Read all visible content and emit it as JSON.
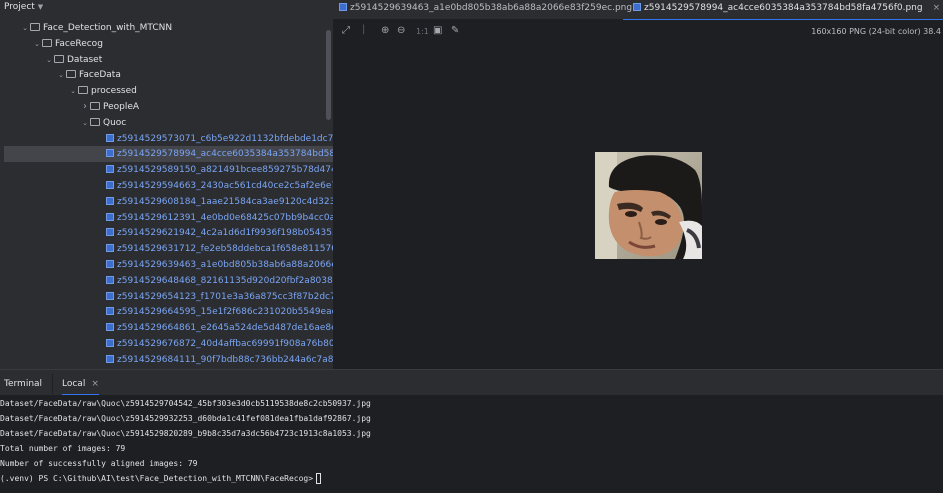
{
  "project": {
    "title": "Project",
    "tree": [
      {
        "label": "Face_Detection_with_MTCNN",
        "kind": "dir",
        "depth": 1,
        "expanded": true
      },
      {
        "label": "FaceRecog",
        "kind": "dir",
        "depth": 2,
        "expanded": true
      },
      {
        "label": "Dataset",
        "kind": "dir",
        "depth": 3,
        "expanded": true
      },
      {
        "label": "FaceData",
        "kind": "dir",
        "depth": 4,
        "expanded": true
      },
      {
        "label": "processed",
        "kind": "dir",
        "depth": 5,
        "expanded": true
      },
      {
        "label": "PeopleA",
        "kind": "dir",
        "depth": 6,
        "expanded": false
      },
      {
        "label": "Quoc",
        "kind": "dir",
        "depth": 6,
        "expanded": true
      },
      {
        "label": "z5914529573071_c6b5e922d1132bfdebde1dc7a6d0",
        "kind": "file",
        "depth": 7
      },
      {
        "label": "z5914529578994_ac4cce6035384a353784bd58fa4",
        "kind": "file",
        "depth": 7,
        "selected": true
      },
      {
        "label": "z5914529589150_a821491bcee859275b78d4743a8",
        "kind": "file",
        "depth": 7
      },
      {
        "label": "z5914529594663_2430ac561cd40ce2c5af2e6e723",
        "kind": "file",
        "depth": 7
      },
      {
        "label": "z5914529608184_1aae21584ca3ae9120c4d3237fdc",
        "kind": "file",
        "depth": 7
      },
      {
        "label": "z5914529612391_4e0bd0e68425c07bb9b4cc0a14f",
        "kind": "file",
        "depth": 7
      },
      {
        "label": "z5914529621942_4c2a1d6d1f9936f198b054353db",
        "kind": "file",
        "depth": 7
      },
      {
        "label": "z5914529631712_fe2eb58ddebca1f658e8115760eb",
        "kind": "file",
        "depth": 7
      },
      {
        "label": "z5914529639463_a1e0bd805b38ab6a88a2066e83",
        "kind": "file",
        "depth": 7
      },
      {
        "label": "z5914529648468_82161135d920d20fbf2a803849d",
        "kind": "file",
        "depth": 7
      },
      {
        "label": "z5914529654123_f1701e3a36a875cc3f87b2dc76ec",
        "kind": "file",
        "depth": 7
      },
      {
        "label": "z5914529664595_15e1f2f686c231020b5549eadd8",
        "kind": "file",
        "depth": 7
      },
      {
        "label": "z5914529664861_e2645a524de5d487de16ae8e94f",
        "kind": "file",
        "depth": 7
      },
      {
        "label": "z5914529676872_40d4affbac69991f908a76b801a",
        "kind": "file",
        "depth": 7
      },
      {
        "label": "z5914529684111_90f7bdb88c736bb244a6c7a8226",
        "kind": "file",
        "depth": 7
      }
    ]
  },
  "editor": {
    "tabs": [
      {
        "label": "z5914529639463_a1e0bd805b38ab6a88a2066e83f259ec.png",
        "active": false
      },
      {
        "label": "z5914529578994_ac4cce6035384a353784bd58fa4756f0.png",
        "active": true
      }
    ],
    "close_glyph": "×",
    "image_info": "160x160 PNG (24-bit color) 38.4",
    "zoom_label": "1:1"
  },
  "terminal": {
    "tab_label": "Terminal",
    "local_label": "Local",
    "lines": [
      "Dataset/FaceData/raw\\Quoc\\z5914529704542_45bf303e3d0cb5119538de8c2cb50937.jpg",
      "Dataset/FaceData/raw\\Quoc\\z5914529932253_d60bda1c41fef081dea1fba1daf92867.jpg",
      "Dataset/FaceData/raw\\Quoc\\z5914529820289_b9b8c35d7a3dc56b4723c1913c8a1053.jpg",
      "Total number of images: 79",
      "Number of successfully aligned images: 79",
      "(.venv) PS C:\\Github\\AI\\test\\Face_Detection_with_MTCNN\\FaceRecog>"
    ]
  },
  "colors": {
    "accent": "#3574f0",
    "file_text": "#7aa5f5",
    "panel": "#2b2d30",
    "editor_bg": "#1e1f22"
  }
}
